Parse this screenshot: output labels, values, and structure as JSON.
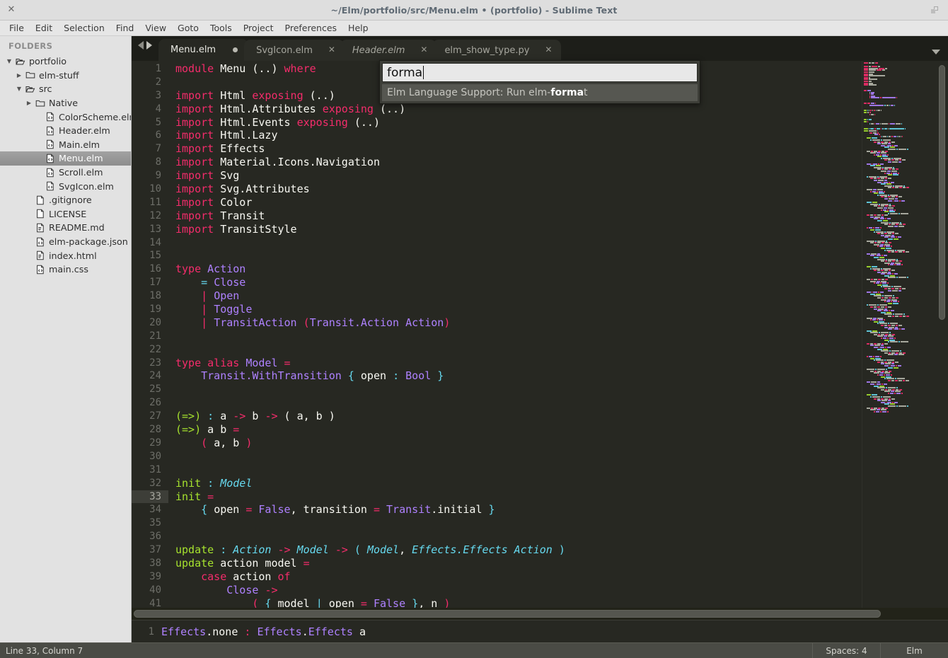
{
  "window": {
    "title": "~/Elm/portfolio/src/Menu.elm • (portfolio) - Sublime Text",
    "close_glyph": "✕"
  },
  "menubar": {
    "items": [
      "File",
      "Edit",
      "Selection",
      "Find",
      "View",
      "Goto",
      "Tools",
      "Project",
      "Preferences",
      "Help"
    ]
  },
  "sidebar": {
    "header": "FOLDERS",
    "items": [
      {
        "label": "portfolio",
        "depth": 0,
        "type": "folder-open",
        "arrow": "▼",
        "selected": false
      },
      {
        "label": "elm-stuff",
        "depth": 1,
        "type": "folder-closed",
        "arrow": "▶",
        "selected": false
      },
      {
        "label": "src",
        "depth": 1,
        "type": "folder-open",
        "arrow": "▼",
        "selected": false
      },
      {
        "label": "Native",
        "depth": 2,
        "type": "folder-closed",
        "arrow": "▶",
        "selected": false
      },
      {
        "label": "ColorScheme.elm",
        "depth": 3,
        "type": "file-code",
        "arrow": "",
        "selected": false
      },
      {
        "label": "Header.elm",
        "depth": 3,
        "type": "file-code",
        "arrow": "",
        "selected": false
      },
      {
        "label": "Main.elm",
        "depth": 3,
        "type": "file-code",
        "arrow": "",
        "selected": false
      },
      {
        "label": "Menu.elm",
        "depth": 3,
        "type": "file-code",
        "arrow": "",
        "selected": true
      },
      {
        "label": "Scroll.elm",
        "depth": 3,
        "type": "file-code",
        "arrow": "",
        "selected": false
      },
      {
        "label": "SvgIcon.elm",
        "depth": 3,
        "type": "file-code",
        "arrow": "",
        "selected": false
      },
      {
        "label": ".gitignore",
        "depth": 2,
        "type": "file-plain",
        "arrow": "",
        "selected": false
      },
      {
        "label": "LICENSE",
        "depth": 2,
        "type": "file-plain",
        "arrow": "",
        "selected": false
      },
      {
        "label": "README.md",
        "depth": 2,
        "type": "file-text",
        "arrow": "",
        "selected": false
      },
      {
        "label": "elm-package.json",
        "depth": 2,
        "type": "file-code",
        "arrow": "",
        "selected": false
      },
      {
        "label": "index.html",
        "depth": 2,
        "type": "file-text",
        "arrow": "",
        "selected": false
      },
      {
        "label": "main.css",
        "depth": 2,
        "type": "file-code",
        "arrow": "",
        "selected": false
      }
    ]
  },
  "tabs": [
    {
      "label": "Menu.elm",
      "active": true,
      "modified": true,
      "preview": false,
      "close_glyph": "✕"
    },
    {
      "label": "SvgIcon.elm",
      "active": false,
      "modified": false,
      "preview": false,
      "close_glyph": "✕"
    },
    {
      "label": "Header.elm",
      "active": false,
      "modified": false,
      "preview": true,
      "close_glyph": "✕"
    },
    {
      "label": "elm_show_type.py",
      "active": false,
      "modified": false,
      "preview": false,
      "close_glyph": "✕"
    }
  ],
  "palette": {
    "query": "forma",
    "result_prefix": "Elm Language Support: Run elm-",
    "result_match": "forma",
    "result_suffix": "t"
  },
  "editor": {
    "active_line": 33,
    "first_line": 1,
    "lines": [
      {
        "n": 1,
        "tokens": [
          {
            "t": "module ",
            "c": "k"
          },
          {
            "t": "Menu ",
            "c": "n"
          },
          {
            "t": "(..) ",
            "c": "n"
          },
          {
            "t": "where",
            "c": "k"
          }
        ]
      },
      {
        "n": 2,
        "tokens": []
      },
      {
        "n": 3,
        "tokens": [
          {
            "t": "import ",
            "c": "k"
          },
          {
            "t": "Html ",
            "c": "n"
          },
          {
            "t": "exposing ",
            "c": "k"
          },
          {
            "t": "(..)",
            "c": "n"
          }
        ]
      },
      {
        "n": 4,
        "tokens": [
          {
            "t": "import ",
            "c": "k"
          },
          {
            "t": "Html.Attributes ",
            "c": "n"
          },
          {
            "t": "exposing ",
            "c": "k"
          },
          {
            "t": "(..)",
            "c": "n"
          }
        ]
      },
      {
        "n": 5,
        "tokens": [
          {
            "t": "import ",
            "c": "k"
          },
          {
            "t": "Html.Events ",
            "c": "n"
          },
          {
            "t": "exposing ",
            "c": "k"
          },
          {
            "t": "(..)",
            "c": "n"
          }
        ]
      },
      {
        "n": 6,
        "tokens": [
          {
            "t": "import ",
            "c": "k"
          },
          {
            "t": "Html.Lazy",
            "c": "n"
          }
        ]
      },
      {
        "n": 7,
        "tokens": [
          {
            "t": "import ",
            "c": "k"
          },
          {
            "t": "Effects",
            "c": "n"
          }
        ]
      },
      {
        "n": 8,
        "tokens": [
          {
            "t": "import ",
            "c": "k"
          },
          {
            "t": "Material.Icons.Navigation",
            "c": "n"
          }
        ]
      },
      {
        "n": 9,
        "tokens": [
          {
            "t": "import ",
            "c": "k"
          },
          {
            "t": "Svg",
            "c": "n"
          }
        ]
      },
      {
        "n": 10,
        "tokens": [
          {
            "t": "import ",
            "c": "k"
          },
          {
            "t": "Svg.Attributes",
            "c": "n"
          }
        ]
      },
      {
        "n": 11,
        "tokens": [
          {
            "t": "import ",
            "c": "k"
          },
          {
            "t": "Color",
            "c": "n"
          }
        ]
      },
      {
        "n": 12,
        "tokens": [
          {
            "t": "import ",
            "c": "k"
          },
          {
            "t": "Transit",
            "c": "n"
          }
        ]
      },
      {
        "n": 13,
        "tokens": [
          {
            "t": "import ",
            "c": "k"
          },
          {
            "t": "TransitStyle",
            "c": "n"
          }
        ]
      },
      {
        "n": 14,
        "tokens": []
      },
      {
        "n": 15,
        "tokens": []
      },
      {
        "n": 16,
        "tokens": [
          {
            "t": "type ",
            "c": "k"
          },
          {
            "t": "Action",
            "c": "t"
          }
        ]
      },
      {
        "n": 17,
        "tokens": [
          {
            "t": "    ",
            "c": "n"
          },
          {
            "t": "= ",
            "c": "p"
          },
          {
            "t": "Close",
            "c": "t"
          }
        ]
      },
      {
        "n": 18,
        "tokens": [
          {
            "t": "    ",
            "c": "n"
          },
          {
            "t": "| ",
            "c": "op"
          },
          {
            "t": "Open",
            "c": "t"
          }
        ]
      },
      {
        "n": 19,
        "tokens": [
          {
            "t": "    ",
            "c": "n"
          },
          {
            "t": "| ",
            "c": "op"
          },
          {
            "t": "Toggle",
            "c": "t"
          }
        ]
      },
      {
        "n": 20,
        "tokens": [
          {
            "t": "    ",
            "c": "n"
          },
          {
            "t": "| ",
            "c": "op"
          },
          {
            "t": "TransitAction ",
            "c": "t"
          },
          {
            "t": "(",
            "c": "op"
          },
          {
            "t": "Transit.Action Action",
            "c": "t"
          },
          {
            "t": ")",
            "c": "op"
          }
        ]
      },
      {
        "n": 21,
        "tokens": []
      },
      {
        "n": 22,
        "tokens": []
      },
      {
        "n": 23,
        "tokens": [
          {
            "t": "type ",
            "c": "k"
          },
          {
            "t": "alias ",
            "c": "k"
          },
          {
            "t": "Model ",
            "c": "t"
          },
          {
            "t": "=",
            "c": "op"
          }
        ]
      },
      {
        "n": 24,
        "tokens": [
          {
            "t": "    ",
            "c": "n"
          },
          {
            "t": "Transit.WithTransition ",
            "c": "t"
          },
          {
            "t": "{ ",
            "c": "p"
          },
          {
            "t": "open ",
            "c": "n"
          },
          {
            "t": ": ",
            "c": "p"
          },
          {
            "t": "Bool ",
            "c": "t"
          },
          {
            "t": "}",
            "c": "p"
          }
        ]
      },
      {
        "n": 25,
        "tokens": []
      },
      {
        "n": 26,
        "tokens": []
      },
      {
        "n": 27,
        "tokens": [
          {
            "t": "(=>) ",
            "c": "fn"
          },
          {
            "t": ": ",
            "c": "p"
          },
          {
            "t": "a ",
            "c": "n"
          },
          {
            "t": "-> ",
            "c": "op"
          },
          {
            "t": "b ",
            "c": "n"
          },
          {
            "t": "-> ",
            "c": "op"
          },
          {
            "t": "( ",
            "c": "n"
          },
          {
            "t": "a, b ",
            "c": "n"
          },
          {
            "t": ")",
            "c": "n"
          }
        ]
      },
      {
        "n": 28,
        "tokens": [
          {
            "t": "(=>) ",
            "c": "fn"
          },
          {
            "t": "a b ",
            "c": "n"
          },
          {
            "t": "=",
            "c": "op"
          }
        ]
      },
      {
        "n": 29,
        "tokens": [
          {
            "t": "    ",
            "c": "n"
          },
          {
            "t": "( ",
            "c": "op"
          },
          {
            "t": "a, b ",
            "c": "n"
          },
          {
            "t": ")",
            "c": "op"
          }
        ]
      },
      {
        "n": 30,
        "tokens": []
      },
      {
        "n": 31,
        "tokens": []
      },
      {
        "n": 32,
        "tokens": [
          {
            "t": "init ",
            "c": "fn"
          },
          {
            "t": ": ",
            "c": "p"
          },
          {
            "t": "Model",
            "c": "ty"
          }
        ]
      },
      {
        "n": 33,
        "tokens": [
          {
            "t": "init ",
            "c": "fn"
          },
          {
            "t": "=",
            "c": "op"
          }
        ]
      },
      {
        "n": 34,
        "tokens": [
          {
            "t": "    ",
            "c": "n"
          },
          {
            "t": "{ ",
            "c": "p"
          },
          {
            "t": "open ",
            "c": "n"
          },
          {
            "t": "= ",
            "c": "op"
          },
          {
            "t": "False",
            "c": "t"
          },
          {
            "t": ", ",
            "c": "n"
          },
          {
            "t": "transition ",
            "c": "n"
          },
          {
            "t": "= ",
            "c": "op"
          },
          {
            "t": "Transit",
            "c": "t"
          },
          {
            "t": ".initial ",
            "c": "n"
          },
          {
            "t": "}",
            "c": "p"
          }
        ]
      },
      {
        "n": 35,
        "tokens": []
      },
      {
        "n": 36,
        "tokens": []
      },
      {
        "n": 37,
        "tokens": [
          {
            "t": "update ",
            "c": "fn"
          },
          {
            "t": ": ",
            "c": "p"
          },
          {
            "t": "Action ",
            "c": "ty"
          },
          {
            "t": "-> ",
            "c": "op"
          },
          {
            "t": "Model ",
            "c": "ty"
          },
          {
            "t": "-> ",
            "c": "op"
          },
          {
            "t": "( ",
            "c": "p"
          },
          {
            "t": "Model",
            "c": "ty"
          },
          {
            "t": ", ",
            "c": "n"
          },
          {
            "t": "Effects.Effects Action ",
            "c": "ty"
          },
          {
            "t": ")",
            "c": "p"
          }
        ]
      },
      {
        "n": 38,
        "tokens": [
          {
            "t": "update ",
            "c": "fn"
          },
          {
            "t": "action model ",
            "c": "n"
          },
          {
            "t": "=",
            "c": "op"
          }
        ]
      },
      {
        "n": 39,
        "tokens": [
          {
            "t": "    ",
            "c": "n"
          },
          {
            "t": "case ",
            "c": "k"
          },
          {
            "t": "action ",
            "c": "n"
          },
          {
            "t": "of",
            "c": "k"
          }
        ]
      },
      {
        "n": 40,
        "tokens": [
          {
            "t": "        ",
            "c": "n"
          },
          {
            "t": "Close ",
            "c": "t"
          },
          {
            "t": "->",
            "c": "op"
          }
        ]
      },
      {
        "n": 41,
        "tokens": [
          {
            "t": "            ",
            "c": "n"
          },
          {
            "t": "( ",
            "c": "op"
          },
          {
            "t": "{ ",
            "c": "p"
          },
          {
            "t": "model ",
            "c": "n"
          },
          {
            "t": "| ",
            "c": "p"
          },
          {
            "t": "open ",
            "c": "n"
          },
          {
            "t": "= ",
            "c": "op"
          },
          {
            "t": "False ",
            "c": "t"
          },
          {
            "t": "}",
            "c": "p"
          },
          {
            "t": ", ",
            "c": "n"
          },
          {
            "t": "n ",
            "c": "n"
          },
          {
            "t": ")",
            "c": "op"
          }
        ]
      }
    ]
  },
  "output_panel": {
    "line_number": "1",
    "tokens": [
      {
        "t": "Effects",
        "c": "t"
      },
      {
        "t": ".none ",
        "c": "n"
      },
      {
        "t": ": ",
        "c": "op"
      },
      {
        "t": "Effects",
        "c": "t"
      },
      {
        "t": ".",
        "c": "n"
      },
      {
        "t": "Effects ",
        "c": "t"
      },
      {
        "t": "a",
        "c": "n"
      }
    ]
  },
  "statusbar": {
    "position": "Line 33, Column 7",
    "indent": "Spaces: 4",
    "syntax": "Elm"
  },
  "colors": {
    "editor_bg": "#272822",
    "keyword": "#f42c6b",
    "type": "#ae81ff",
    "annotation": "#66d9ef",
    "function": "#a6e22e",
    "text": "#f8f8f2",
    "sidebar_bg": "#e2e2e2",
    "titlebar_bg": "#dedede",
    "statusbar_bg": "#4a4b45"
  }
}
